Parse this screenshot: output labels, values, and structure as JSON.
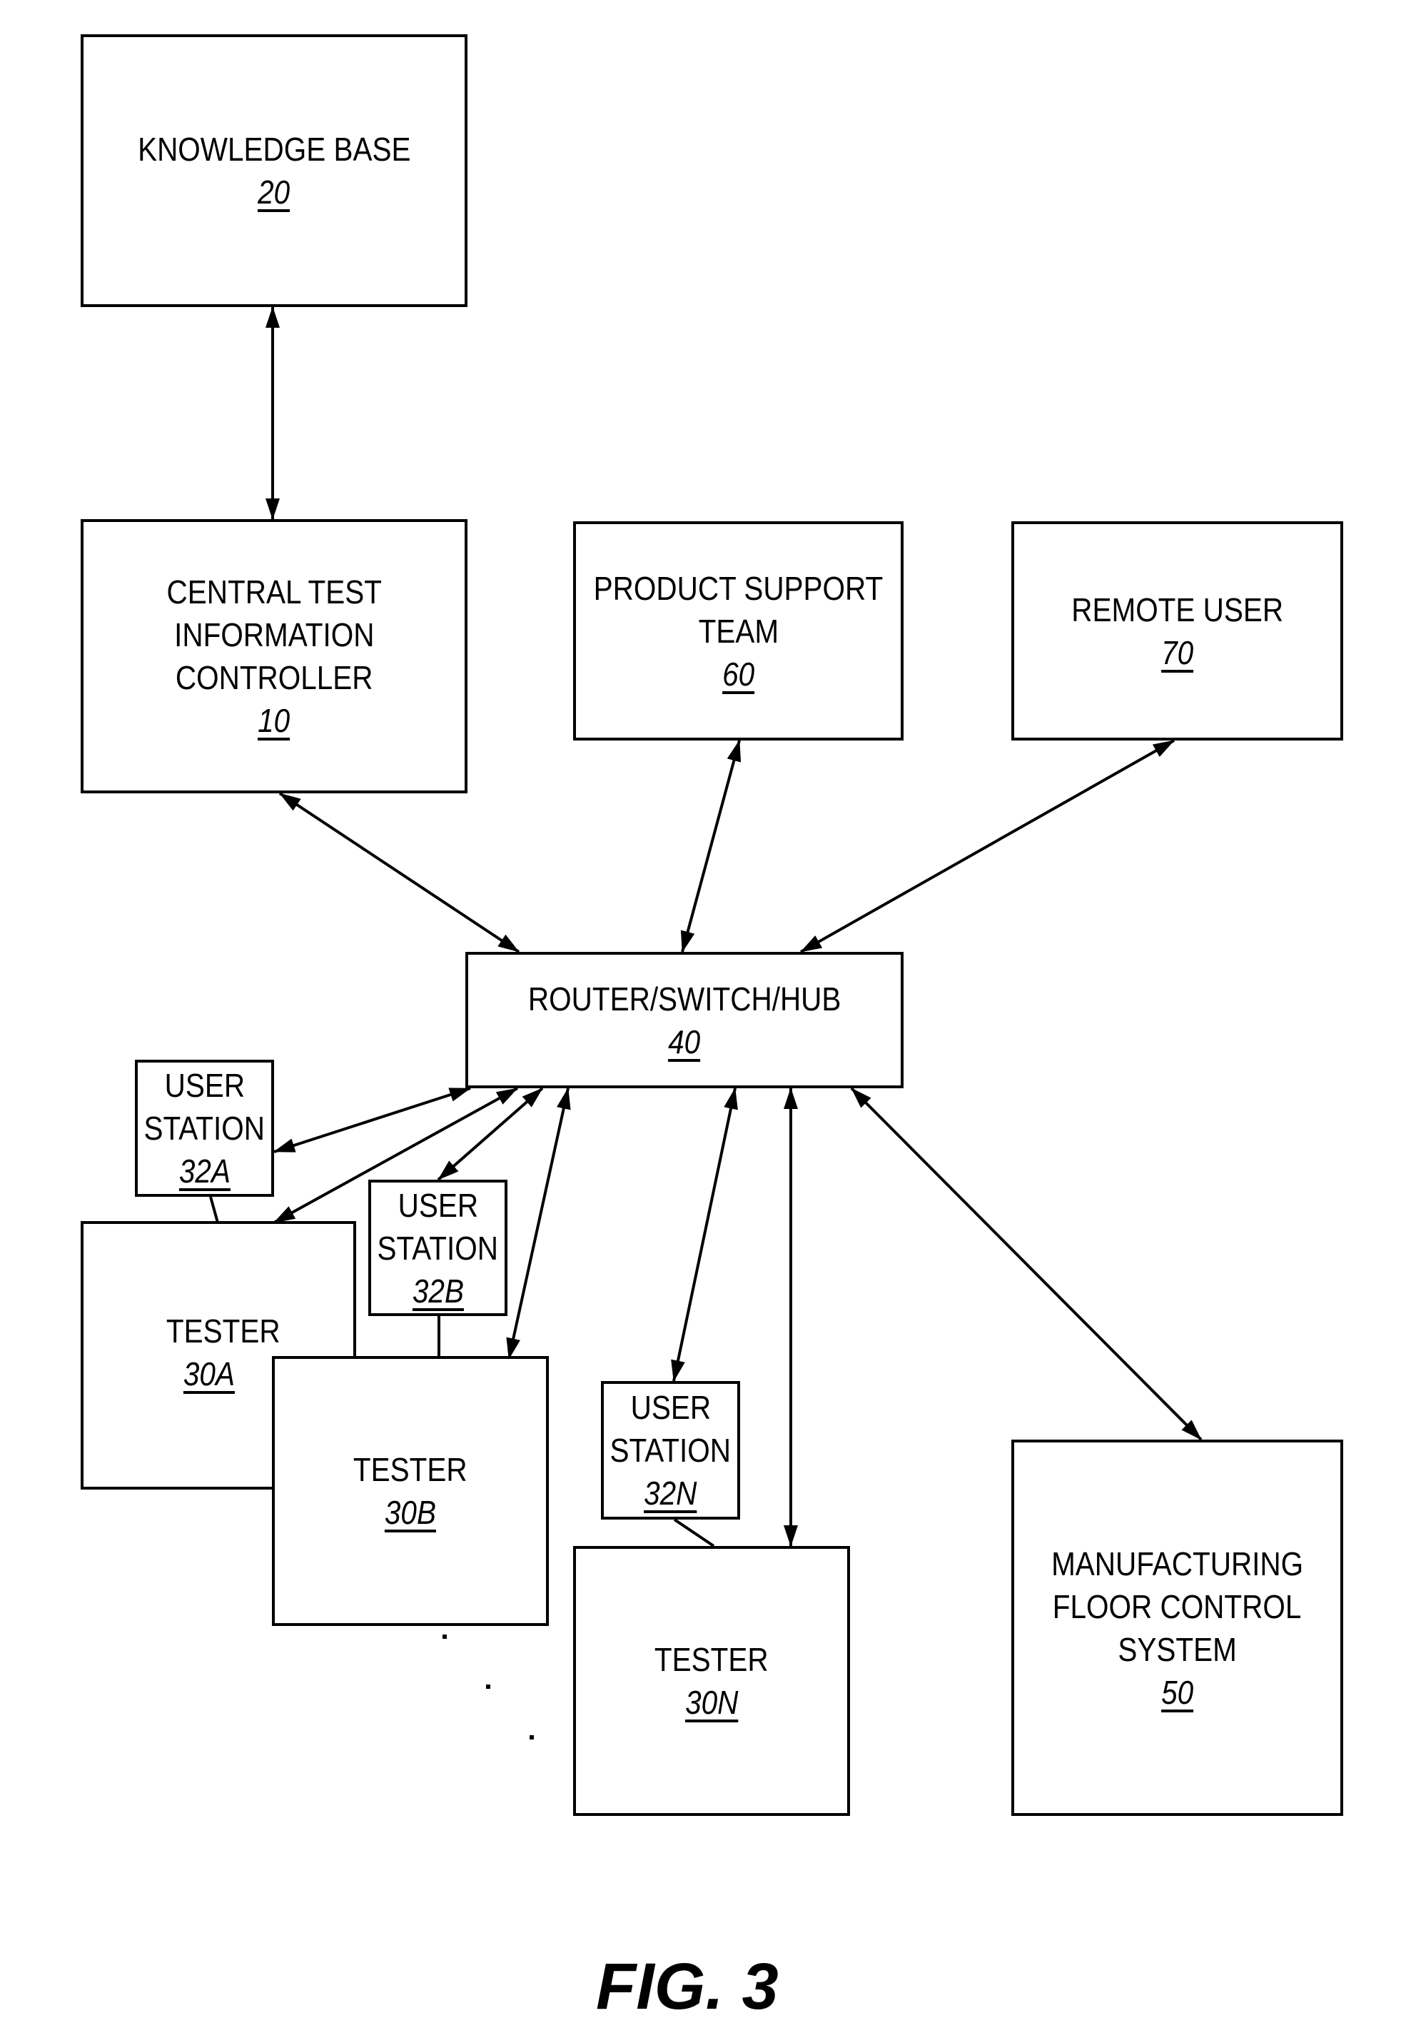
{
  "figure_label": "FIG. 3",
  "nodes": {
    "knowledge_base": {
      "label": "KNOWLEDGE BASE",
      "ref": "20"
    },
    "controller": {
      "label": "CENTRAL TEST INFORMATION CONTROLLER",
      "lines": [
        "CENTRAL TEST",
        "INFORMATION",
        "CONTROLLER"
      ],
      "ref": "10"
    },
    "product_support": {
      "lines": [
        "PRODUCT SUPPORT",
        "TEAM"
      ],
      "ref": "60"
    },
    "remote_user": {
      "label": "REMOTE USER",
      "ref": "70"
    },
    "router": {
      "label": "ROUTER/SWITCH/HUB",
      "ref": "40"
    },
    "user_station_a": {
      "lines": [
        "USER",
        "STATION"
      ],
      "ref": "32A"
    },
    "user_station_b": {
      "lines": [
        "USER",
        "STATION"
      ],
      "ref": "32B"
    },
    "user_station_n": {
      "lines": [
        "USER",
        "STATION"
      ],
      "ref": "32N"
    },
    "tester_a": {
      "label": "TESTER",
      "ref": "30A"
    },
    "tester_b": {
      "label": "TESTER",
      "ref": "30B"
    },
    "tester_n": {
      "label": "TESTER",
      "ref": "30N"
    },
    "mfg_floor": {
      "lines": [
        "MANUFACTURING",
        "FLOOR CONTROL",
        "SYSTEM"
      ],
      "ref": "50"
    }
  },
  "edges": [
    {
      "from": "knowledge_base",
      "to": "controller",
      "type": "bidirectional"
    },
    {
      "from": "controller",
      "to": "router",
      "type": "bidirectional"
    },
    {
      "from": "product_support",
      "to": "router",
      "type": "bidirectional"
    },
    {
      "from": "remote_user",
      "to": "router",
      "type": "bidirectional"
    },
    {
      "from": "user_station_a",
      "to": "router",
      "type": "bidirectional"
    },
    {
      "from": "tester_a",
      "to": "router",
      "type": "bidirectional"
    },
    {
      "from": "user_station_b",
      "to": "router",
      "type": "bidirectional"
    },
    {
      "from": "tester_b",
      "to": "router",
      "type": "bidirectional"
    },
    {
      "from": "user_station_n",
      "to": "router",
      "type": "bidirectional"
    },
    {
      "from": "tester_n",
      "to": "router",
      "type": "bidirectional"
    },
    {
      "from": "mfg_floor",
      "to": "router",
      "type": "bidirectional"
    },
    {
      "from": "user_station_a",
      "to": "tester_a",
      "type": "line"
    },
    {
      "from": "user_station_b",
      "to": "tester_b",
      "type": "line"
    },
    {
      "from": "user_station_n",
      "to": "tester_n",
      "type": "line"
    }
  ]
}
